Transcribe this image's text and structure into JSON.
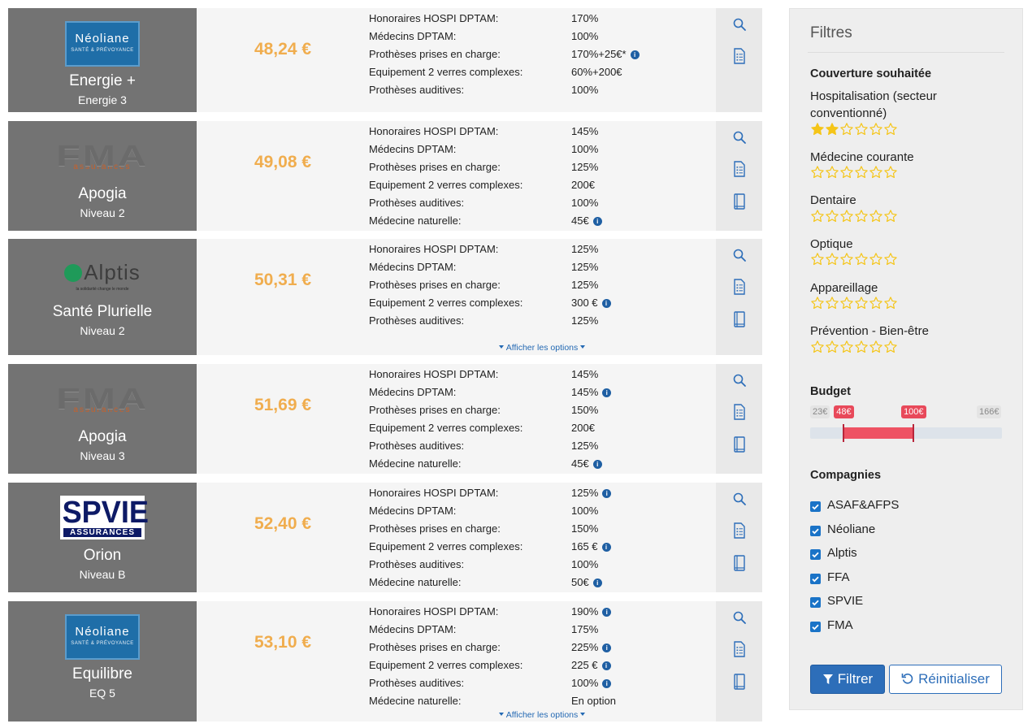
{
  "offers": [
    {
      "logo": "Néoliane",
      "logo_tagline": "SANTÉ & PRÉVOYANCE",
      "name": "Energie +",
      "level": "Energie 3",
      "price": "48,24 €",
      "features": [
        {
          "label": "Honoraires HOSPI DPTAM:",
          "value": "170%",
          "info": false
        },
        {
          "label": "Médecins DPTAM:",
          "value": "100%",
          "info": false
        },
        {
          "label": "Prothèses prises en charge:",
          "value": "170%+25€*",
          "info": true
        },
        {
          "label": "Equipement 2 verres complexes:",
          "value": "60%+200€",
          "info": false
        },
        {
          "label": "Prothèses auditives:",
          "value": "100%",
          "info": false
        }
      ]
    },
    {
      "logo": "FMA",
      "logo_tagline": "assurances",
      "name": "Apogia",
      "level": "Niveau 2",
      "price": "49,08 €",
      "features": [
        {
          "label": "Honoraires HOSPI DPTAM:",
          "value": "145%",
          "info": false
        },
        {
          "label": "Médecins DPTAM:",
          "value": "100%",
          "info": false
        },
        {
          "label": "Prothèses prises en charge:",
          "value": "125%",
          "info": false
        },
        {
          "label": "Equipement 2 verres complexes:",
          "value": "200€",
          "info": false
        },
        {
          "label": "Prothèses auditives:",
          "value": "100%",
          "info": false
        },
        {
          "label": "Médecine naturelle:",
          "value": "45€",
          "info": true
        }
      ]
    },
    {
      "logo": "Alptis",
      "logo_tagline": "la solidarité change le monde",
      "name": "Santé Plurielle",
      "level": "Niveau 2",
      "price": "50,31 €",
      "options_link": "Afficher les options",
      "features": [
        {
          "label": "Honoraires HOSPI DPTAM:",
          "value": "125%",
          "info": false
        },
        {
          "label": "Médecins DPTAM:",
          "value": "125%",
          "info": false
        },
        {
          "label": "Prothèses prises en charge:",
          "value": "125%",
          "info": false
        },
        {
          "label": "Equipement 2 verres complexes:",
          "value": "300 €",
          "info": true
        },
        {
          "label": "Prothèses auditives:",
          "value": "125%",
          "info": false
        }
      ]
    },
    {
      "logo": "FMA",
      "logo_tagline": "assurances",
      "name": "Apogia",
      "level": "Niveau 3",
      "price": "51,69 €",
      "features": [
        {
          "label": "Honoraires HOSPI DPTAM:",
          "value": "145%",
          "info": false
        },
        {
          "label": "Médecins DPTAM:",
          "value": "145%",
          "info": true
        },
        {
          "label": "Prothèses prises en charge:",
          "value": "150%",
          "info": false
        },
        {
          "label": "Equipement 2 verres complexes:",
          "value": "200€",
          "info": false
        },
        {
          "label": "Prothèses auditives:",
          "value": "125%",
          "info": false
        },
        {
          "label": "Médecine naturelle:",
          "value": "45€",
          "info": true
        }
      ]
    },
    {
      "logo": "SPVIE",
      "logo_tagline": "ASSURANCES",
      "name": "Orion",
      "level": "Niveau B",
      "price": "52,40 €",
      "features": [
        {
          "label": "Honoraires HOSPI DPTAM:",
          "value": "125%",
          "info": true
        },
        {
          "label": "Médecins DPTAM:",
          "value": "100%",
          "info": false
        },
        {
          "label": "Prothèses prises en charge:",
          "value": "150%",
          "info": false
        },
        {
          "label": "Equipement 2 verres complexes:",
          "value": "165 €",
          "info": true
        },
        {
          "label": "Prothèses auditives:",
          "value": "100%",
          "info": false
        },
        {
          "label": "Médecine naturelle:",
          "value": "50€",
          "info": true
        }
      ]
    },
    {
      "logo": "Néoliane",
      "logo_tagline": "SANTÉ & PRÉVOYANCE",
      "name": "Equilibre",
      "level": "EQ 5",
      "price": "53,10 €",
      "options_link": "Afficher les options",
      "features": [
        {
          "label": "Honoraires HOSPI DPTAM:",
          "value": "190%",
          "info": true
        },
        {
          "label": "Médecins DPTAM:",
          "value": "175%",
          "info": false
        },
        {
          "label": "Prothèses prises en charge:",
          "value": "225%",
          "info": true
        },
        {
          "label": "Equipement 2 verres complexes:",
          "value": "225 €",
          "info": true
        },
        {
          "label": "Prothèses auditives:",
          "value": "100%",
          "info": true
        },
        {
          "label": "Médecine naturelle:",
          "value": "En option",
          "info": false
        }
      ]
    }
  ],
  "action_icons": [
    "search-icon",
    "document-list-icon",
    "book-icon"
  ],
  "filters": {
    "title": "Filtres",
    "coverage_heading": "Couverture souhaitée",
    "criteria": [
      {
        "label": "Hospitalisation (secteur conventionné)",
        "stars": 2,
        "max_stars": 6
      },
      {
        "label": "Médecine courante",
        "stars": 0,
        "max_stars": 6
      },
      {
        "label": "Dentaire",
        "stars": 0,
        "max_stars": 6
      },
      {
        "label": "Optique",
        "stars": 0,
        "max_stars": 6
      },
      {
        "label": "Appareillage",
        "stars": 0,
        "max_stars": 6
      },
      {
        "label": "Prévention - Bien-être",
        "stars": 0,
        "max_stars": 6
      }
    ],
    "budget_heading": "Budget",
    "budget": {
      "min": 23,
      "max": 166,
      "low": 48,
      "high": 100,
      "min_label": "23€",
      "max_label": "166€",
      "low_label": "48€",
      "high_label": "100€"
    },
    "companies_heading": "Compagnies",
    "companies": [
      {
        "label": "ASAF&AFPS",
        "checked": true
      },
      {
        "label": "Néoliane",
        "checked": true
      },
      {
        "label": "Alptis",
        "checked": true
      },
      {
        "label": "FFA",
        "checked": true
      },
      {
        "label": "SPVIE",
        "checked": true
      },
      {
        "label": "FMA",
        "checked": true
      }
    ],
    "filter_button": "Filtrer",
    "reset_button": "Réinitialiser"
  },
  "colors": {
    "price": "#f0ad4e",
    "accent": "#2d6eb9",
    "budget_range": "#ee5263",
    "star": "#f5c518"
  }
}
